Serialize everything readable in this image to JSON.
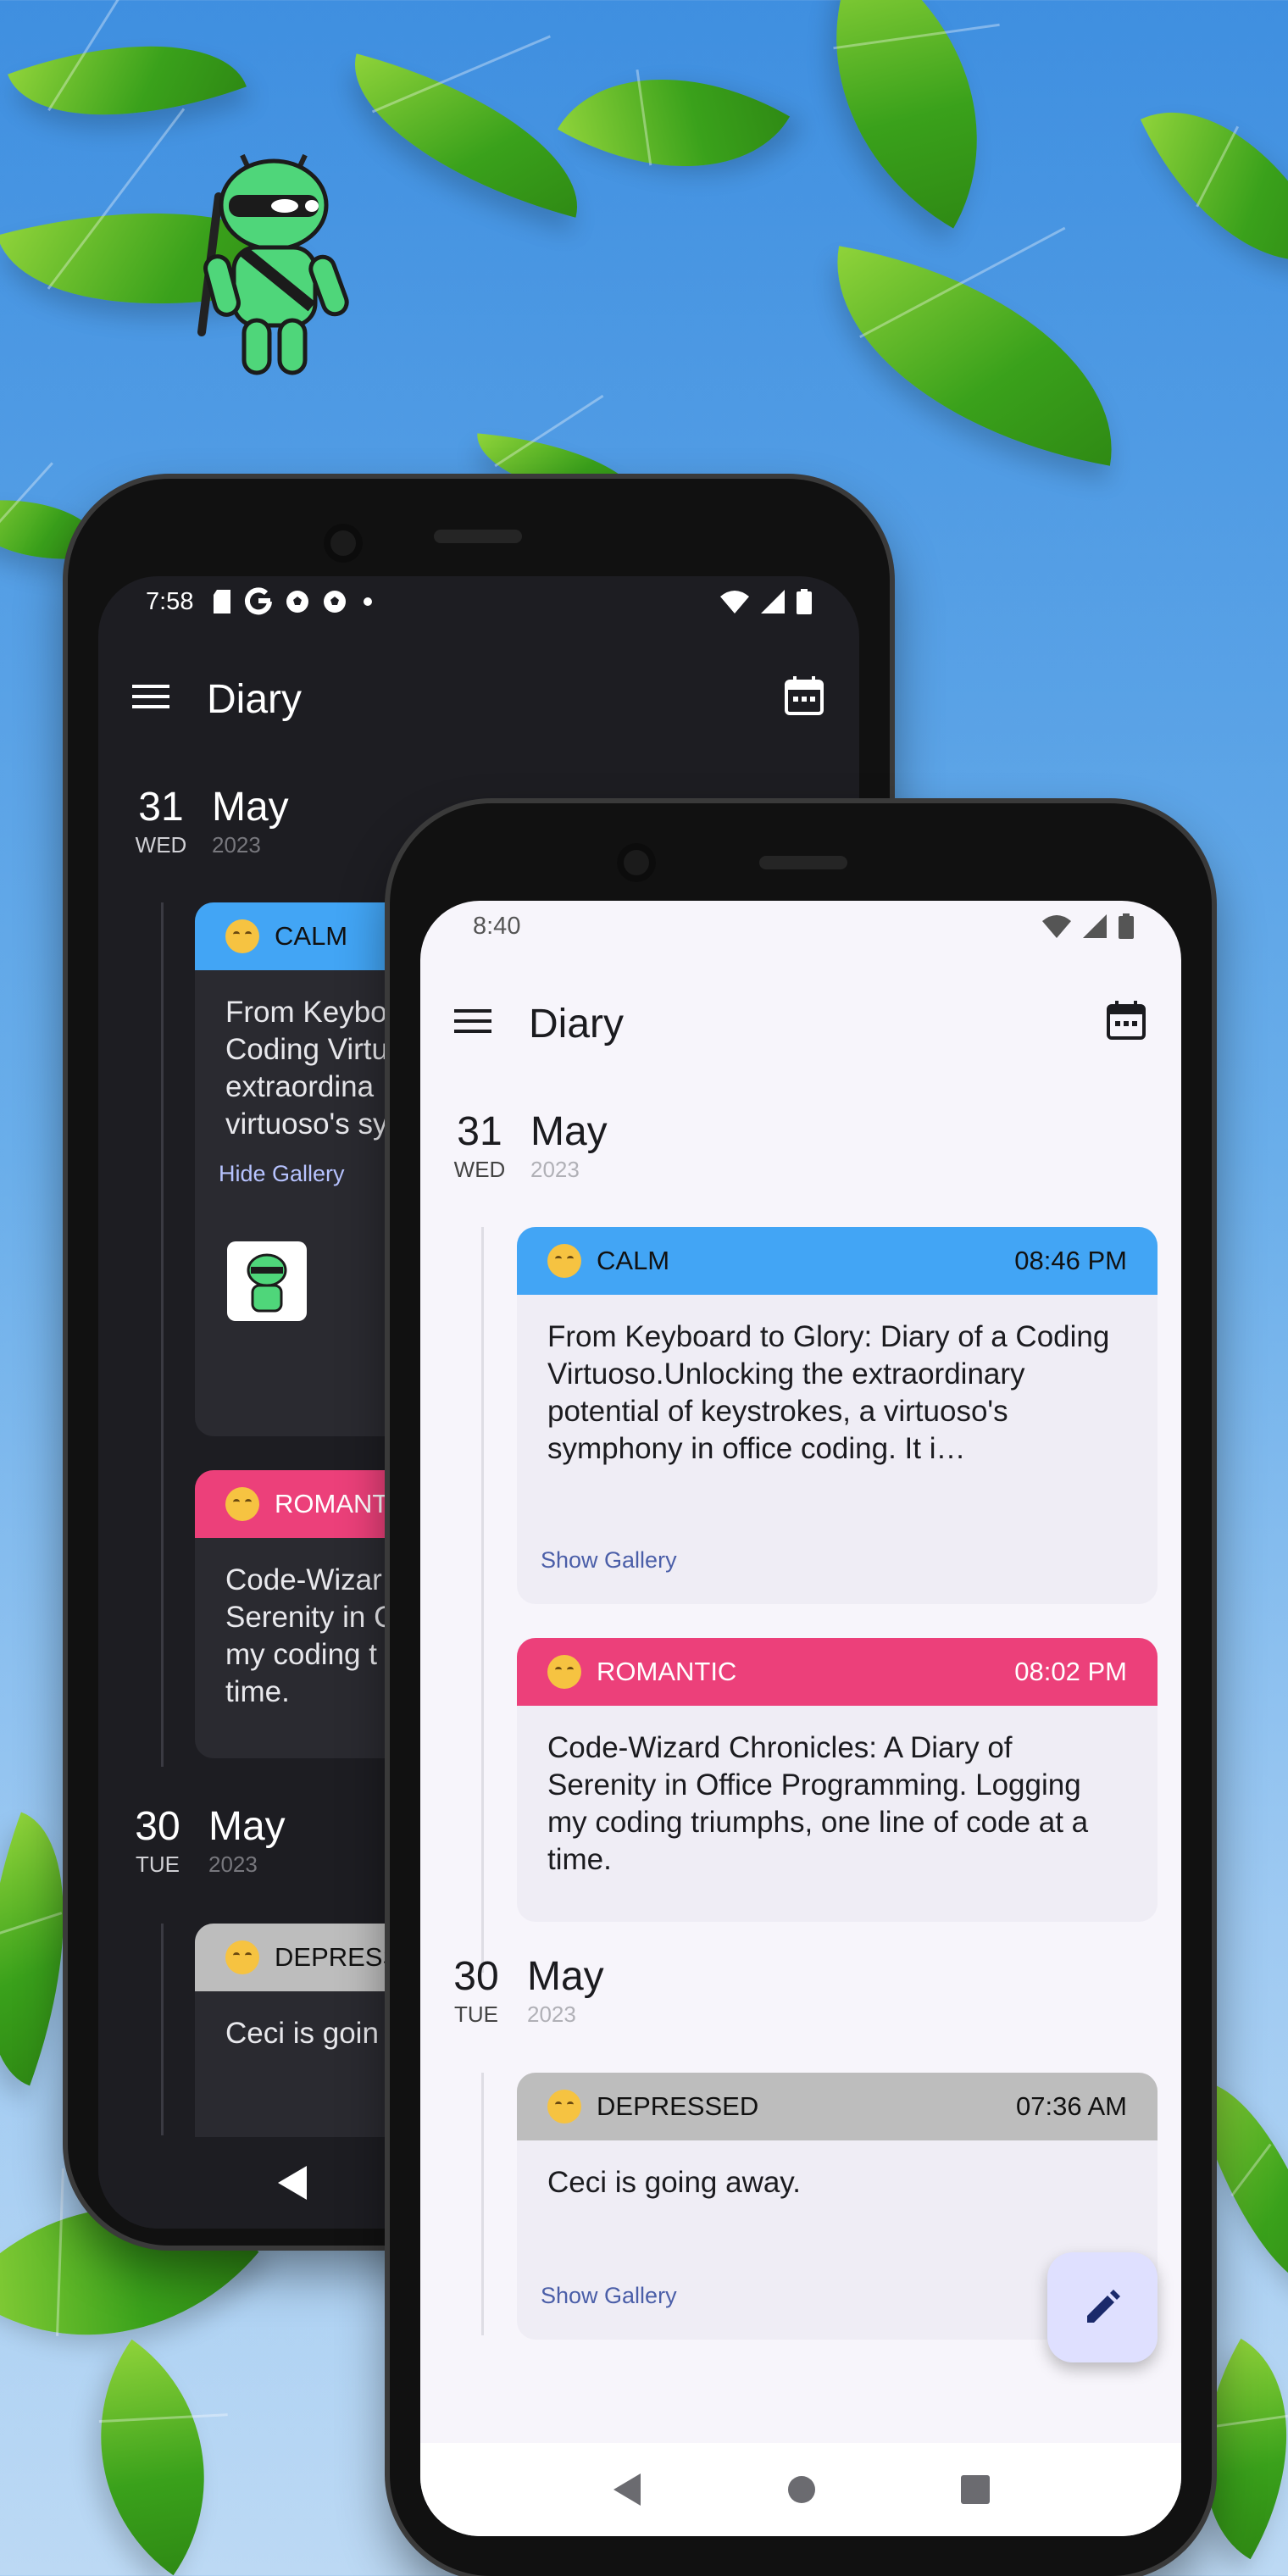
{
  "colors": {
    "calm": "#42a5f5",
    "romantic": "#ec407a",
    "depressed": "#bdbdbd",
    "dark_surface": "#1d1d22",
    "dark_card": "#2a2a30",
    "light_surface": "#f7f5fb",
    "light_card": "#efedf5",
    "fab": "#dfe0ff"
  },
  "dark_phone": {
    "status": {
      "time": "7:58",
      "icons": [
        "sd-card-icon",
        "google-icon",
        "soccer-ball-icon",
        "soccer-ball-icon",
        "dot-icon",
        "wifi-icon",
        "signal-icon",
        "battery-icon"
      ]
    },
    "appbar": {
      "title": "Diary",
      "menu_icon": "menu-icon",
      "calendar_icon": "calendar-icon"
    },
    "days": [
      {
        "day": "31",
        "dow": "WED",
        "month": "May",
        "year": "2023"
      },
      {
        "day": "30",
        "dow": "TUE",
        "month": "May",
        "year": "2023"
      }
    ],
    "entries": [
      {
        "mood": "CALM",
        "text": "From Keybo\nCoding Virtu\nextraordina\nvirtuoso's sy",
        "gallery_label": "Hide Gallery"
      },
      {
        "mood": "ROMANT",
        "text": "Code-Wizar\nSerenity in C\nmy coding t\ntime."
      },
      {
        "mood": "DEPRESS",
        "text": "Ceci is goin"
      }
    ]
  },
  "light_phone": {
    "status": {
      "time": "8:40",
      "icons": [
        "wifi-icon",
        "signal-icon",
        "battery-icon"
      ]
    },
    "appbar": {
      "title": "Diary",
      "menu_icon": "menu-icon",
      "calendar_icon": "calendar-icon"
    },
    "days": [
      {
        "day": "31",
        "dow": "WED",
        "month": "May",
        "year": "2023"
      },
      {
        "day": "30",
        "dow": "TUE",
        "month": "May",
        "year": "2023"
      }
    ],
    "entries": [
      {
        "mood": "CALM",
        "time": "08:46 PM",
        "text": "From Keyboard to Glory: Diary of a Coding Virtuoso.Unlocking the extraordinary potential of keystrokes, a virtuoso's symphony in office coding. It i…",
        "gallery_label": "Show Gallery"
      },
      {
        "mood": "ROMANTIC",
        "time": "08:02 PM",
        "text": "Code-Wizard Chronicles: A Diary of Serenity in Office Programming. Logging my coding triumphs, one line of code at a time."
      },
      {
        "mood": "DEPRESSED",
        "time": "07:36 AM",
        "text": "Ceci is going away.",
        "gallery_label": "Show Gallery"
      }
    ],
    "fab_icon": "edit-icon"
  }
}
